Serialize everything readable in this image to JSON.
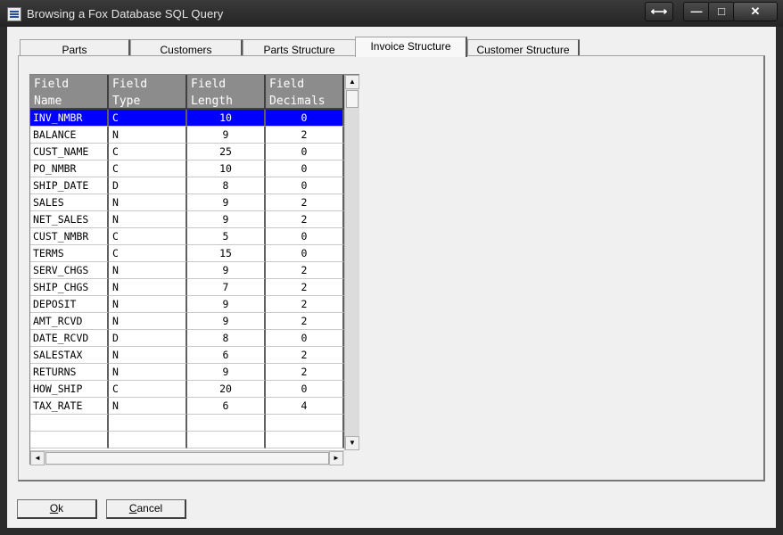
{
  "window": {
    "title": "Browsing a Fox Database SQL Query",
    "caption_buttons": {
      "resize": "⟷",
      "minimize": "—",
      "maximize": "□",
      "close": "✕"
    }
  },
  "tabs": [
    {
      "label": "Parts",
      "active": false
    },
    {
      "label": "Customers",
      "active": false
    },
    {
      "label": "Parts Structure",
      "active": false
    },
    {
      "label": "Invoice Structure",
      "active": true
    },
    {
      "label": "Customer Structure",
      "active": false
    }
  ],
  "grid": {
    "headers": [
      {
        "line1": "Field",
        "line2": "Name"
      },
      {
        "line1": "Field",
        "line2": "Type"
      },
      {
        "line1": "Field",
        "line2": "Length"
      },
      {
        "line1": "Field",
        "line2": "Decimals"
      }
    ],
    "rows": [
      {
        "name": "INV_NMBR",
        "type": "C",
        "length": "10",
        "decimals": "0",
        "selected": true
      },
      {
        "name": "BALANCE",
        "type": "N",
        "length": "9",
        "decimals": "2"
      },
      {
        "name": "CUST_NAME",
        "type": "C",
        "length": "25",
        "decimals": "0"
      },
      {
        "name": "PO_NMBR",
        "type": "C",
        "length": "10",
        "decimals": "0"
      },
      {
        "name": "SHIP_DATE",
        "type": "D",
        "length": "8",
        "decimals": "0"
      },
      {
        "name": "SALES",
        "type": "N",
        "length": "9",
        "decimals": "2"
      },
      {
        "name": "NET_SALES",
        "type": "N",
        "length": "9",
        "decimals": "2"
      },
      {
        "name": "CUST_NMBR",
        "type": "C",
        "length": "5",
        "decimals": "0"
      },
      {
        "name": "TERMS",
        "type": "C",
        "length": "15",
        "decimals": "0"
      },
      {
        "name": "SERV_CHGS",
        "type": "N",
        "length": "9",
        "decimals": "2"
      },
      {
        "name": "SHIP_CHGS",
        "type": "N",
        "length": "7",
        "decimals": "2"
      },
      {
        "name": "DEPOSIT",
        "type": "N",
        "length": "9",
        "decimals": "2"
      },
      {
        "name": "AMT_RCVD",
        "type": "N",
        "length": "9",
        "decimals": "2"
      },
      {
        "name": "DATE_RCVD",
        "type": "D",
        "length": "8",
        "decimals": "0"
      },
      {
        "name": "SALESTAX",
        "type": "N",
        "length": "6",
        "decimals": "2"
      },
      {
        "name": "RETURNS",
        "type": "N",
        "length": "9",
        "decimals": "2"
      },
      {
        "name": "HOW_SHIP",
        "type": "C",
        "length": "20",
        "decimals": "0"
      },
      {
        "name": "TAX_RATE",
        "type": "N",
        "length": "6",
        "decimals": "4"
      }
    ],
    "empty_rows": 2,
    "scroll_icons": {
      "up": "▲",
      "down": "▼",
      "left": "◄",
      "right": "►"
    }
  },
  "buttons": {
    "ok": {
      "accel": "O",
      "rest": "k"
    },
    "cancel": {
      "accel": "C",
      "rest": "ancel"
    }
  }
}
